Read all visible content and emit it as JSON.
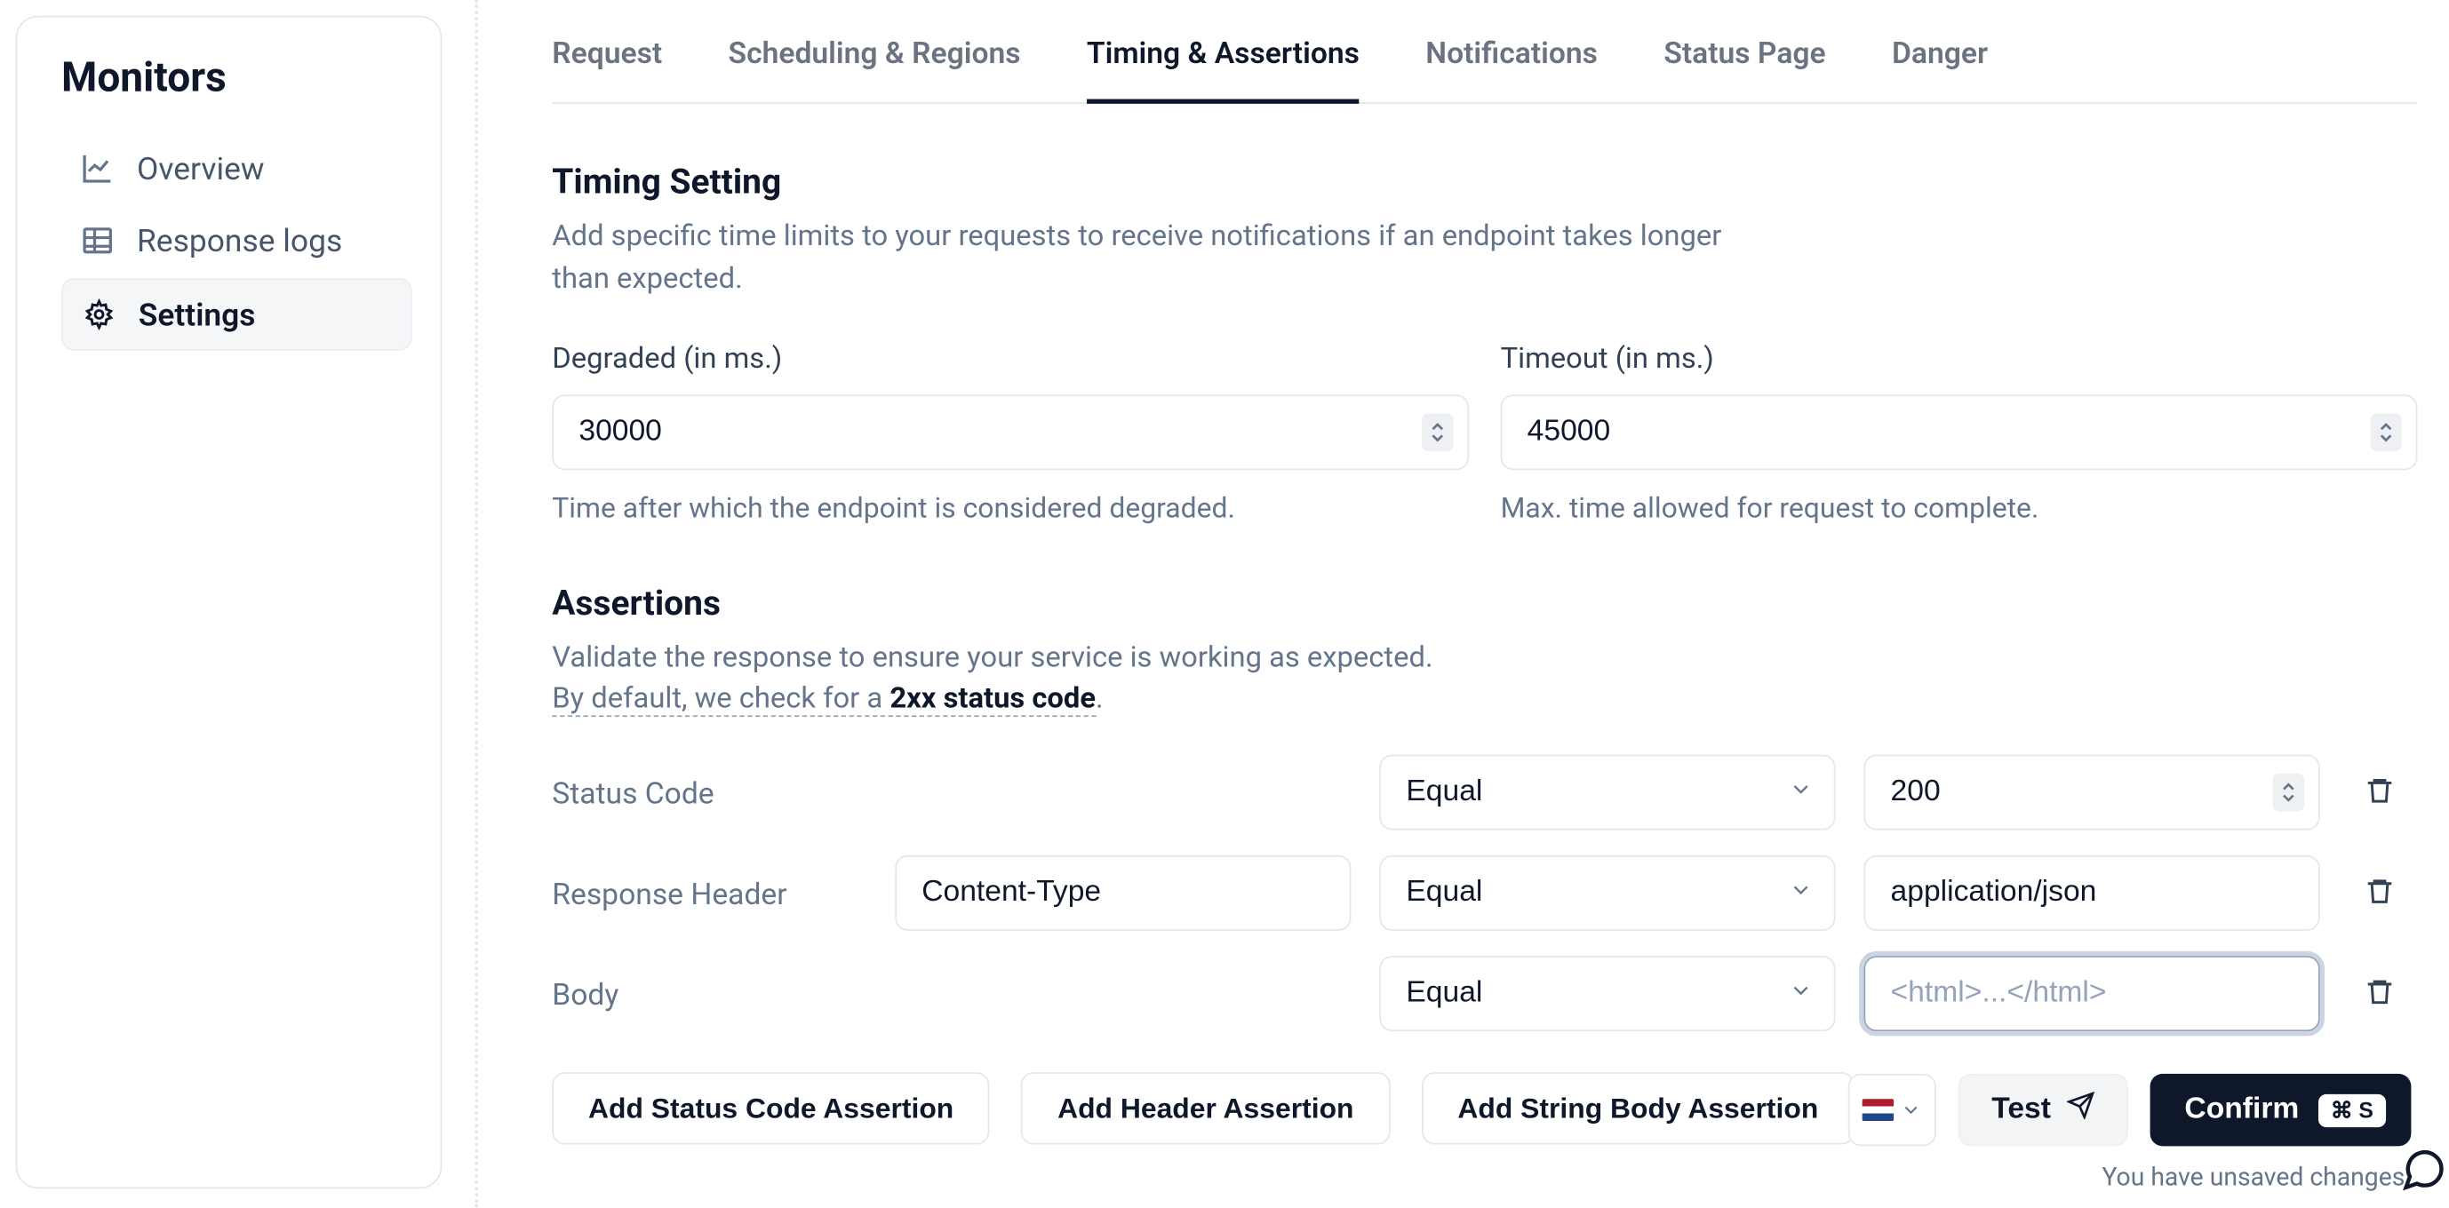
{
  "sidebar": {
    "title": "Monitors",
    "items": [
      {
        "label": "Overview",
        "icon": "chart-line"
      },
      {
        "label": "Response logs",
        "icon": "table"
      },
      {
        "label": "Settings",
        "icon": "gear",
        "active": true
      }
    ]
  },
  "tabs": [
    {
      "label": "Request"
    },
    {
      "label": "Scheduling & Regions"
    },
    {
      "label": "Timing & Assertions",
      "active": true
    },
    {
      "label": "Notifications"
    },
    {
      "label": "Status Page"
    },
    {
      "label": "Danger"
    }
  ],
  "timing": {
    "title": "Timing Setting",
    "desc": "Add specific time limits to your requests to receive notifications if an endpoint takes longer than expected.",
    "degraded": {
      "label": "Degraded (in ms.)",
      "value": "30000",
      "help": "Time after which the endpoint is considered degraded."
    },
    "timeout": {
      "label": "Timeout (in ms.)",
      "value": "45000",
      "help": "Max. time allowed for request to complete."
    }
  },
  "assertions": {
    "title": "Assertions",
    "desc1": "Validate the response to ensure your service is working as expected.",
    "desc2_pre": "By default, we check for a ",
    "desc2_bold": "2xx status code",
    "desc2_post": ".",
    "rows": [
      {
        "label": "Status Code",
        "key": "",
        "op": "Equal",
        "value": "200",
        "valuePlaceholder": "200",
        "numeric": true
      },
      {
        "label": "Response Header",
        "key": "Content-Type",
        "op": "Equal",
        "value": "application/json",
        "keyPlaceholder": "Key",
        "valuePlaceholder": "Value"
      },
      {
        "label": "Body",
        "key": "",
        "op": "Equal",
        "value": "",
        "valuePlaceholder": "<html>...</html>",
        "focused": true
      }
    ],
    "buttons": {
      "addStatus": "Add Status Code Assertion",
      "addHeader": "Add Header Assertion",
      "addBody": "Add String Body Assertion"
    }
  },
  "footer": {
    "region": "NL",
    "test": "Test",
    "confirm": "Confirm",
    "shortcut": "⌘ S",
    "unsaved": "You have unsaved changes"
  }
}
